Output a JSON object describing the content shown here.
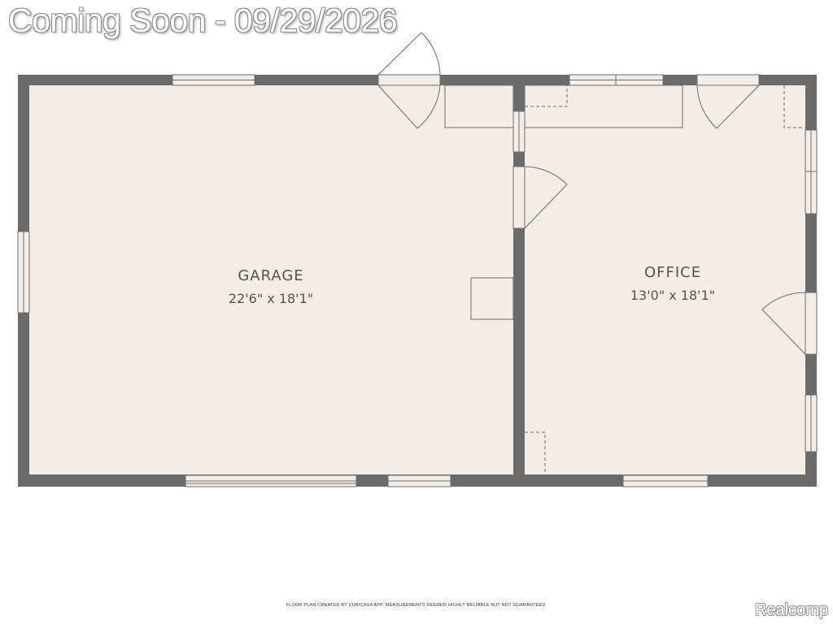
{
  "banner": {
    "text": "Coming Soon - 09/29/2026"
  },
  "rooms": {
    "garage": {
      "name": "GARAGE",
      "dims": "22'6\" x 18'1\""
    },
    "office": {
      "name": "OFFICE",
      "dims": "13'0\" x 18'1\""
    }
  },
  "footer": {
    "text": "FLOOR PLAN CREATED BY CUBICASA APP. MEASUREMENTS DEEMED HIGHLY RELIABLE BUT NOT GUARANTEED."
  },
  "watermark": {
    "text": "Realcomp"
  },
  "colors": {
    "wall": "#6b6b6b",
    "floor": "#f3ece7",
    "fixture_line": "#6b6b6b",
    "window_fill": "#f3ece7"
  }
}
